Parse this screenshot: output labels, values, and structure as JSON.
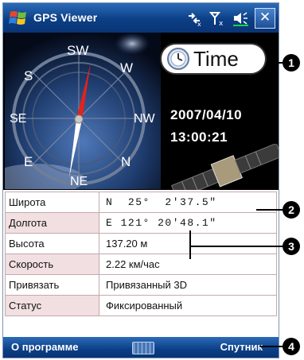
{
  "window": {
    "title": "GPS Viewer",
    "close_label": "✕"
  },
  "compass": {
    "directions": [
      "SW",
      "W",
      "S",
      "NW",
      "SE",
      "N",
      "E",
      "NE"
    ]
  },
  "time_panel": {
    "button_label": "Time",
    "date": "2007/04/10",
    "time": "13:00:21"
  },
  "info": {
    "rows": [
      {
        "label": "Широта",
        "value": "N  25°  2'37.5\""
      },
      {
        "label": "Долгота",
        "value": "E 121° 20'48.1\""
      },
      {
        "label": "Высота",
        "value": "137.20 м"
      },
      {
        "label": "Скорость",
        "value": "2.22 км/час"
      },
      {
        "label": "Привязать",
        "value": "Привязанный 3D"
      },
      {
        "label": "Статус",
        "value": "Фиксированный"
      }
    ]
  },
  "bottom_bar": {
    "left_label": "О программе",
    "right_label": "Спутник"
  },
  "callouts": [
    "1",
    "2",
    "3",
    "4"
  ],
  "colors": {
    "titlebar": "#0b3f86",
    "label_alt_row": "#f1dfe1",
    "table_border": "#c4a9ad"
  }
}
